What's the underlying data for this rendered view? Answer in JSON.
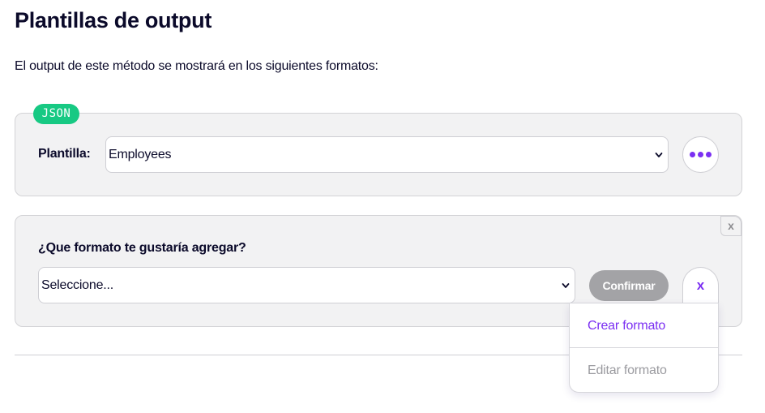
{
  "page": {
    "title": "Plantillas de output",
    "subtitle": "El output de este método se mostrará en los siguientes formatos:"
  },
  "template_card": {
    "badge": "JSON",
    "label": "Plantilla:",
    "selected_template": "Employees",
    "more_icon": "ellipsis-icon"
  },
  "format_card": {
    "question": "¿Que formato te gustaría agregar?",
    "select_placeholder": "Seleccione...",
    "confirm_label": "Confirmar",
    "close_label": "x",
    "corner_close_label": "x"
  },
  "dropdown_menu": {
    "items": [
      {
        "label": "Crear formato",
        "enabled": true
      },
      {
        "label": "Editar formato",
        "enabled": false
      }
    ]
  },
  "colors": {
    "accent": "#7b2ff2",
    "badge_green": "#17c983",
    "disabled_gray": "#a3a3a6",
    "card_bg": "#f2f2f3"
  }
}
